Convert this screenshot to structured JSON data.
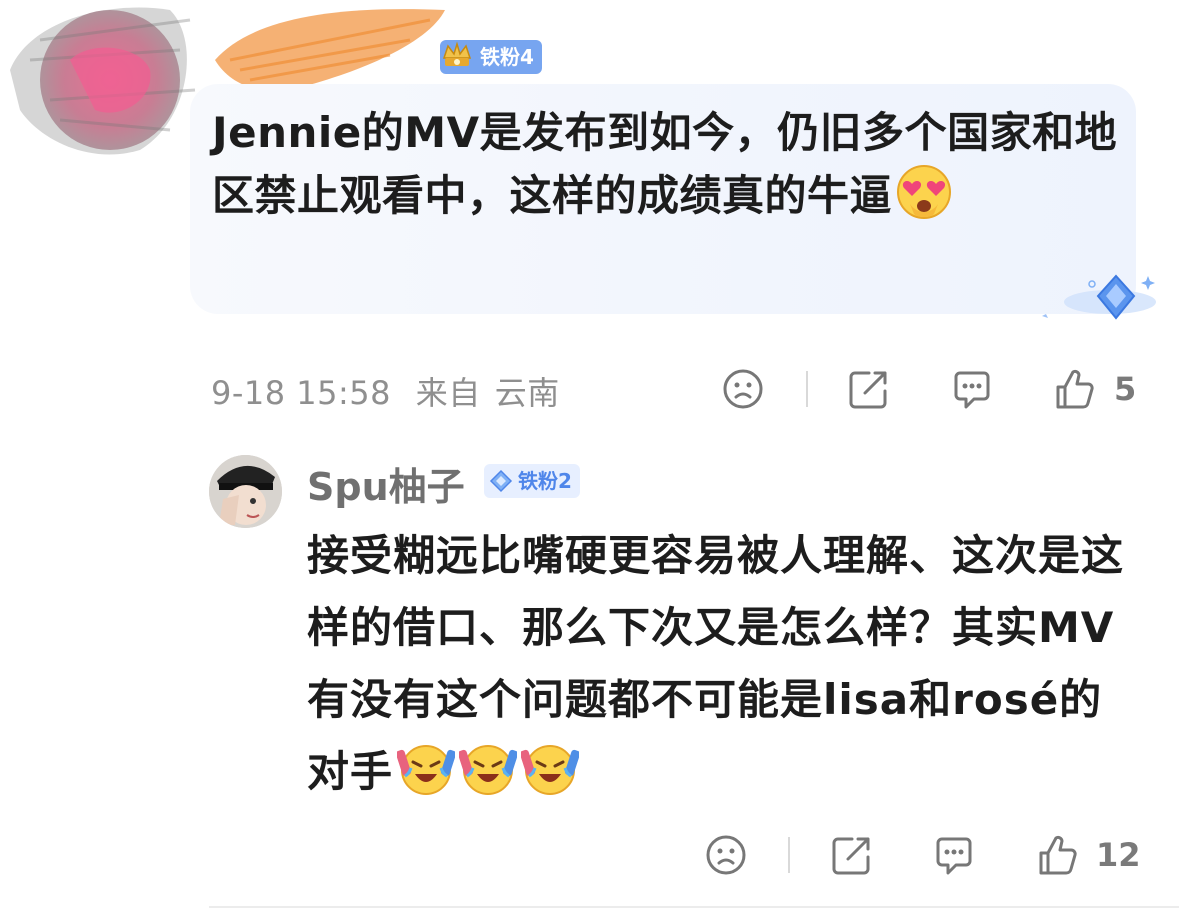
{
  "comment": {
    "badge_label": "铁粉4",
    "text": "Jennie的MV是发布到如今，仍旧多个国家和地区禁止观看中，这样的成绩真的牛逼",
    "emoji": "heart-eyes-face-icon",
    "date": "9-18 15:58",
    "location_prefix": "来自",
    "location": "云南",
    "like_count": "5"
  },
  "reply": {
    "username": "Spu柚子",
    "badge_label": "铁粉2",
    "text": "接受糊远比嘴硬更容易被人理解、这次是这样的借口、那么下次又是怎么样？其实MV有没有这个问题都不可能是lisa和rosé的对手",
    "emojis": [
      "laughing-crying-face-icon",
      "laughing-crying-face-icon",
      "laughing-crying-face-icon"
    ],
    "like_count": "12"
  },
  "colors": {
    "badge_blue": "#77a5f0",
    "bubble_bg": "#f1f5fd",
    "meta_gray": "#8f8f8f"
  }
}
